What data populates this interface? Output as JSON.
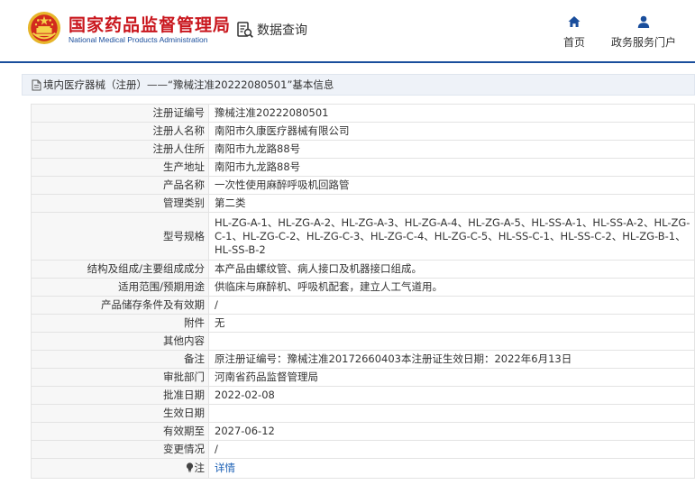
{
  "header": {
    "brand_cn": "国家药品监督管理局",
    "brand_en": "National Medical Products Administration",
    "query_label": "数据查询",
    "nav": [
      {
        "label": "首页",
        "icon": "home-icon"
      },
      {
        "label": "政务服务门户",
        "icon": "user-icon"
      }
    ]
  },
  "breadcrumb": {
    "icon": "document-icon",
    "text": "境内医疗器械（注册）——“豫械注准20222080501”基本信息"
  },
  "details": [
    {
      "label": "注册证编号",
      "value": "豫械注准20222080501"
    },
    {
      "label": "注册人名称",
      "value": "南阳市久康医疗器械有限公司"
    },
    {
      "label": "注册人住所",
      "value": "南阳市九龙路88号"
    },
    {
      "label": "生产地址",
      "value": "南阳市九龙路88号"
    },
    {
      "label": "产品名称",
      "value": "一次性使用麻醉呼吸机回路管"
    },
    {
      "label": "管理类别",
      "value": "第二类"
    },
    {
      "label": "型号规格",
      "value": "HL-ZG-A-1、HL-ZG-A-2、HL-ZG-A-3、HL-ZG-A-4、HL-ZG-A-5、HL-SS-A-1、HL-SS-A-2、HL-ZG-C-1、HL-ZG-C-2、HL-ZG-C-3、HL-ZG-C-4、HL-ZG-C-5、HL-SS-C-1、HL-SS-C-2、HL-ZG-B-1、HL-SS-B-2"
    },
    {
      "label": "结构及组成/主要组成成分",
      "value": "本产品由螺纹管、病人接口及机器接口组成。"
    },
    {
      "label": "适用范围/预期用途",
      "value": "供临床与麻醉机、呼吸机配套，建立人工气道用。"
    },
    {
      "label": "产品储存条件及有效期",
      "value": "/"
    },
    {
      "label": "附件",
      "value": "无"
    },
    {
      "label": "其他内容",
      "value": ""
    },
    {
      "label": "备注",
      "value": "原注册证编号：豫械注准20172660403本注册证生效日期：2022年6月13日"
    },
    {
      "label": "审批部门",
      "value": "河南省药品监督管理局"
    },
    {
      "label": "批准日期",
      "value": "2022-02-08"
    },
    {
      "label": "生效日期",
      "value": ""
    },
    {
      "label": "有效期至",
      "value": "2027-06-12"
    },
    {
      "label": "变更情况",
      "value": "/"
    }
  ],
  "note_row": {
    "label": "注",
    "icon": "lightbulb-icon",
    "link": "详情"
  },
  "colors": {
    "brand_red": "#c9161d",
    "brand_blue": "#1a4e9c",
    "link": "#1a5fb4"
  }
}
